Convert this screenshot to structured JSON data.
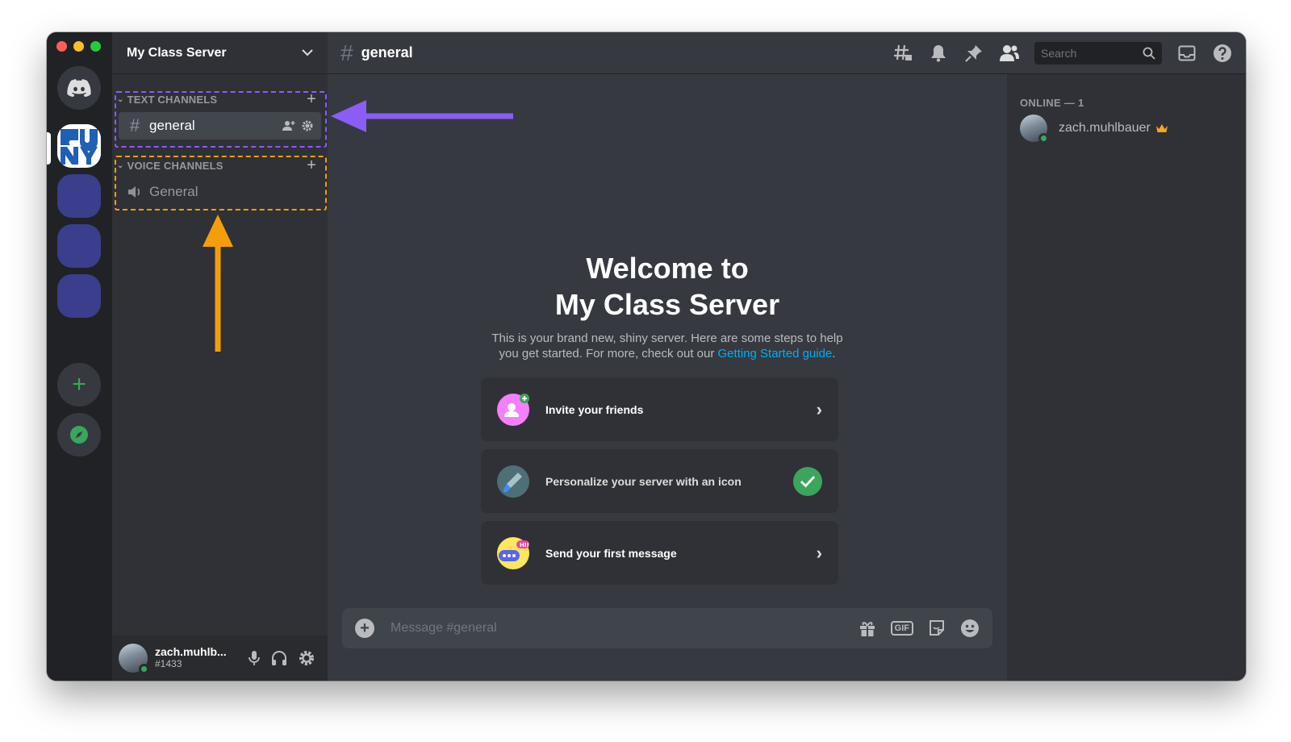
{
  "server": {
    "name": "My Class Server"
  },
  "categories": {
    "text": {
      "label": "TEXT CHANNELS"
    },
    "voice": {
      "label": "VOICE CHANNELS"
    }
  },
  "channels": {
    "text": [
      {
        "name": "general"
      }
    ],
    "voice": [
      {
        "name": "General"
      }
    ]
  },
  "header": {
    "channel_name": "general",
    "search_placeholder": "Search"
  },
  "welcome": {
    "title_line1": "Welcome to",
    "title_line2": "My Class Server",
    "body": "This is your brand new, shiny server. Here are some steps to help you get started. For more, check out our ",
    "link_text": "Getting Started guide",
    "body_end": "."
  },
  "cards": [
    {
      "label": "Invite your friends",
      "done": false
    },
    {
      "label": "Personalize your server with an icon",
      "done": true
    },
    {
      "label": "Send your first message",
      "done": false
    }
  ],
  "composer": {
    "placeholder": "Message #general",
    "gif_label": "GIF"
  },
  "members": {
    "header": "ONLINE — 1",
    "list": [
      {
        "name": "zach.muhlbauer",
        "owner": true
      }
    ]
  },
  "user": {
    "name": "zach.muhlb...",
    "tag": "#1433"
  },
  "rail": {
    "cuny_logo_text": "CUNY"
  },
  "colors": {
    "annotation_purple": "#8b5cf6",
    "annotation_orange": "#f59e0b",
    "online_green": "#3ba55d",
    "link_blue": "#00aff4"
  }
}
